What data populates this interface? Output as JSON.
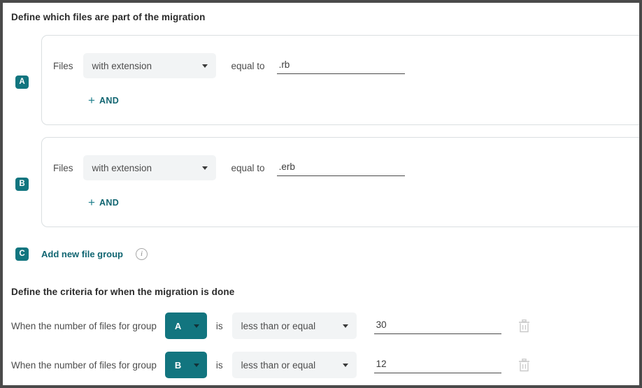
{
  "headings": {
    "files_section": "Define which files are part of the migration",
    "criteria_section": "Define the criteria for when the migration is done"
  },
  "colors": {
    "accent_teal": "#12757f",
    "link_teal": "#106571",
    "field_gray": "#f2f4f5",
    "text_gray": "#4d4d4d"
  },
  "file_groups": [
    {
      "badge": "A",
      "subject_label": "Files",
      "attribute_value": "with extension",
      "operator_label": "equal to",
      "value": ".rb",
      "and_plus": "+",
      "and_label": "AND"
    },
    {
      "badge": "B",
      "subject_label": "Files",
      "attribute_value": "with extension",
      "operator_label": "equal to",
      "value": ".erb",
      "and_plus": "+",
      "and_label": "AND"
    }
  ],
  "add_group": {
    "badge": "C",
    "label": "Add new file group",
    "info_glyph": "i"
  },
  "criteria": [
    {
      "prefix_text": "When the number of files for group",
      "group": "A",
      "is_label": "is",
      "operator": "less than or equal",
      "value": "30"
    },
    {
      "prefix_text": "When the number of files for group",
      "group": "B",
      "is_label": "is",
      "operator": "less than or equal",
      "value": "12"
    }
  ]
}
